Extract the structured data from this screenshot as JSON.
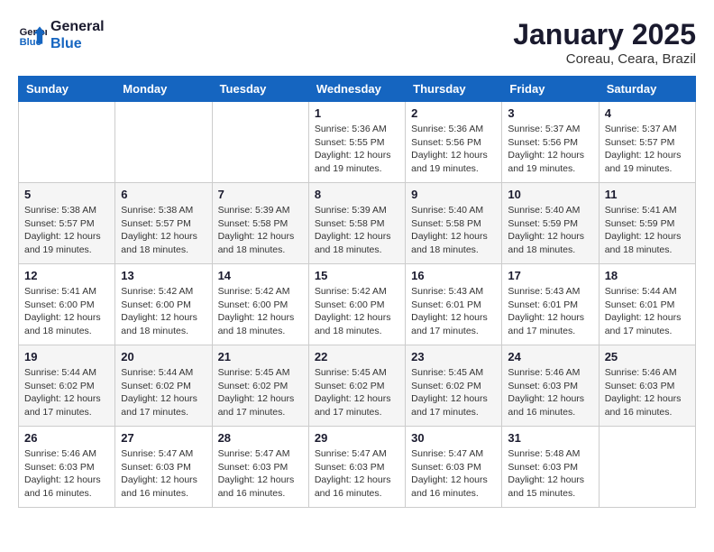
{
  "header": {
    "logo_line1": "General",
    "logo_line2": "Blue",
    "month_year": "January 2025",
    "location": "Coreau, Ceara, Brazil"
  },
  "weekdays": [
    "Sunday",
    "Monday",
    "Tuesday",
    "Wednesday",
    "Thursday",
    "Friday",
    "Saturday"
  ],
  "weeks": [
    [
      {
        "day": "",
        "sunrise": "",
        "sunset": "",
        "daylight": ""
      },
      {
        "day": "",
        "sunrise": "",
        "sunset": "",
        "daylight": ""
      },
      {
        "day": "",
        "sunrise": "",
        "sunset": "",
        "daylight": ""
      },
      {
        "day": "1",
        "sunrise": "Sunrise: 5:36 AM",
        "sunset": "Sunset: 5:55 PM",
        "daylight": "Daylight: 12 hours and 19 minutes."
      },
      {
        "day": "2",
        "sunrise": "Sunrise: 5:36 AM",
        "sunset": "Sunset: 5:56 PM",
        "daylight": "Daylight: 12 hours and 19 minutes."
      },
      {
        "day": "3",
        "sunrise": "Sunrise: 5:37 AM",
        "sunset": "Sunset: 5:56 PM",
        "daylight": "Daylight: 12 hours and 19 minutes."
      },
      {
        "day": "4",
        "sunrise": "Sunrise: 5:37 AM",
        "sunset": "Sunset: 5:57 PM",
        "daylight": "Daylight: 12 hours and 19 minutes."
      }
    ],
    [
      {
        "day": "5",
        "sunrise": "Sunrise: 5:38 AM",
        "sunset": "Sunset: 5:57 PM",
        "daylight": "Daylight: 12 hours and 19 minutes."
      },
      {
        "day": "6",
        "sunrise": "Sunrise: 5:38 AM",
        "sunset": "Sunset: 5:57 PM",
        "daylight": "Daylight: 12 hours and 18 minutes."
      },
      {
        "day": "7",
        "sunrise": "Sunrise: 5:39 AM",
        "sunset": "Sunset: 5:58 PM",
        "daylight": "Daylight: 12 hours and 18 minutes."
      },
      {
        "day": "8",
        "sunrise": "Sunrise: 5:39 AM",
        "sunset": "Sunset: 5:58 PM",
        "daylight": "Daylight: 12 hours and 18 minutes."
      },
      {
        "day": "9",
        "sunrise": "Sunrise: 5:40 AM",
        "sunset": "Sunset: 5:58 PM",
        "daylight": "Daylight: 12 hours and 18 minutes."
      },
      {
        "day": "10",
        "sunrise": "Sunrise: 5:40 AM",
        "sunset": "Sunset: 5:59 PM",
        "daylight": "Daylight: 12 hours and 18 minutes."
      },
      {
        "day": "11",
        "sunrise": "Sunrise: 5:41 AM",
        "sunset": "Sunset: 5:59 PM",
        "daylight": "Daylight: 12 hours and 18 minutes."
      }
    ],
    [
      {
        "day": "12",
        "sunrise": "Sunrise: 5:41 AM",
        "sunset": "Sunset: 6:00 PM",
        "daylight": "Daylight: 12 hours and 18 minutes."
      },
      {
        "day": "13",
        "sunrise": "Sunrise: 5:42 AM",
        "sunset": "Sunset: 6:00 PM",
        "daylight": "Daylight: 12 hours and 18 minutes."
      },
      {
        "day": "14",
        "sunrise": "Sunrise: 5:42 AM",
        "sunset": "Sunset: 6:00 PM",
        "daylight": "Daylight: 12 hours and 18 minutes."
      },
      {
        "day": "15",
        "sunrise": "Sunrise: 5:42 AM",
        "sunset": "Sunset: 6:00 PM",
        "daylight": "Daylight: 12 hours and 18 minutes."
      },
      {
        "day": "16",
        "sunrise": "Sunrise: 5:43 AM",
        "sunset": "Sunset: 6:01 PM",
        "daylight": "Daylight: 12 hours and 17 minutes."
      },
      {
        "day": "17",
        "sunrise": "Sunrise: 5:43 AM",
        "sunset": "Sunset: 6:01 PM",
        "daylight": "Daylight: 12 hours and 17 minutes."
      },
      {
        "day": "18",
        "sunrise": "Sunrise: 5:44 AM",
        "sunset": "Sunset: 6:01 PM",
        "daylight": "Daylight: 12 hours and 17 minutes."
      }
    ],
    [
      {
        "day": "19",
        "sunrise": "Sunrise: 5:44 AM",
        "sunset": "Sunset: 6:02 PM",
        "daylight": "Daylight: 12 hours and 17 minutes."
      },
      {
        "day": "20",
        "sunrise": "Sunrise: 5:44 AM",
        "sunset": "Sunset: 6:02 PM",
        "daylight": "Daylight: 12 hours and 17 minutes."
      },
      {
        "day": "21",
        "sunrise": "Sunrise: 5:45 AM",
        "sunset": "Sunset: 6:02 PM",
        "daylight": "Daylight: 12 hours and 17 minutes."
      },
      {
        "day": "22",
        "sunrise": "Sunrise: 5:45 AM",
        "sunset": "Sunset: 6:02 PM",
        "daylight": "Daylight: 12 hours and 17 minutes."
      },
      {
        "day": "23",
        "sunrise": "Sunrise: 5:45 AM",
        "sunset": "Sunset: 6:02 PM",
        "daylight": "Daylight: 12 hours and 17 minutes."
      },
      {
        "day": "24",
        "sunrise": "Sunrise: 5:46 AM",
        "sunset": "Sunset: 6:03 PM",
        "daylight": "Daylight: 12 hours and 16 minutes."
      },
      {
        "day": "25",
        "sunrise": "Sunrise: 5:46 AM",
        "sunset": "Sunset: 6:03 PM",
        "daylight": "Daylight: 12 hours and 16 minutes."
      }
    ],
    [
      {
        "day": "26",
        "sunrise": "Sunrise: 5:46 AM",
        "sunset": "Sunset: 6:03 PM",
        "daylight": "Daylight: 12 hours and 16 minutes."
      },
      {
        "day": "27",
        "sunrise": "Sunrise: 5:47 AM",
        "sunset": "Sunset: 6:03 PM",
        "daylight": "Daylight: 12 hours and 16 minutes."
      },
      {
        "day": "28",
        "sunrise": "Sunrise: 5:47 AM",
        "sunset": "Sunset: 6:03 PM",
        "daylight": "Daylight: 12 hours and 16 minutes."
      },
      {
        "day": "29",
        "sunrise": "Sunrise: 5:47 AM",
        "sunset": "Sunset: 6:03 PM",
        "daylight": "Daylight: 12 hours and 16 minutes."
      },
      {
        "day": "30",
        "sunrise": "Sunrise: 5:47 AM",
        "sunset": "Sunset: 6:03 PM",
        "daylight": "Daylight: 12 hours and 16 minutes."
      },
      {
        "day": "31",
        "sunrise": "Sunrise: 5:48 AM",
        "sunset": "Sunset: 6:03 PM",
        "daylight": "Daylight: 12 hours and 15 minutes."
      },
      {
        "day": "",
        "sunrise": "",
        "sunset": "",
        "daylight": ""
      }
    ]
  ],
  "colors": {
    "header_bg": "#1565c0",
    "header_text": "#ffffff",
    "accent": "#1565c0"
  }
}
